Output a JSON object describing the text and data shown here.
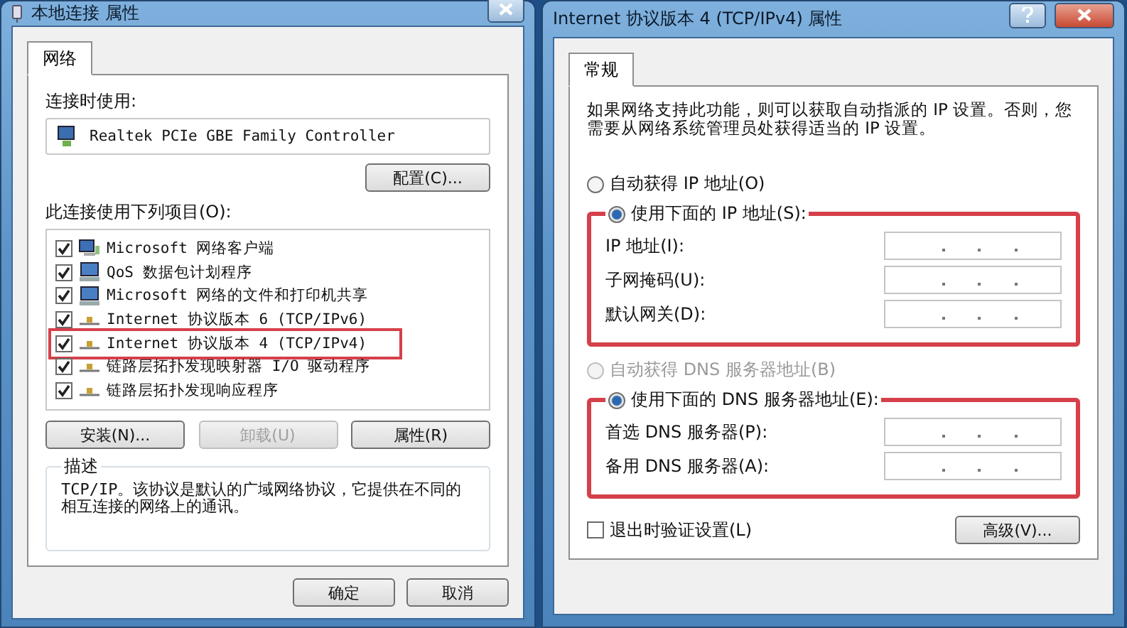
{
  "left_window": {
    "title": "本地连接 属性",
    "tabs": [
      {
        "label": "网络",
        "selected": true
      }
    ],
    "connect_using_label": "连接时使用:",
    "adapter": "Realtek PCIe GBE Family Controller",
    "configure_button": "配置(C)...",
    "items_label": "此连接使用下列项目(O):",
    "items": [
      {
        "kind": "client",
        "label": "Microsoft 网络客户端",
        "checked": true,
        "highlighted": false
      },
      {
        "kind": "service",
        "label": "QoS 数据包计划程序",
        "checked": true,
        "highlighted": false
      },
      {
        "kind": "service",
        "label": "Microsoft 网络的文件和打印机共享",
        "checked": true,
        "highlighted": false
      },
      {
        "kind": "protocol",
        "label": "Internet 协议版本 6 (TCP/IPv6)",
        "checked": true,
        "highlighted": false
      },
      {
        "kind": "protocol",
        "label": "Internet 协议版本 4 (TCP/IPv4)",
        "checked": true,
        "highlighted": true
      },
      {
        "kind": "protocol",
        "label": "链路层拓扑发现映射器 I/O 驱动程序",
        "checked": true,
        "highlighted": false
      },
      {
        "kind": "protocol",
        "label": "链路层拓扑发现响应程序",
        "checked": true,
        "highlighted": false
      }
    ],
    "item_buttons": [
      {
        "label": "安装(N)...",
        "disabled": false
      },
      {
        "label": "卸载(U)",
        "disabled": true
      },
      {
        "label": "属性(R)",
        "disabled": false
      }
    ],
    "description": {
      "title": "描述",
      "text": "TCP/IP。该协议是默认的广域网络协议，它提供在不同的相互连接的网络上的通讯。"
    },
    "footer_buttons": [
      "确定",
      "取消"
    ]
  },
  "right_window": {
    "title": "Internet 协议版本 4 (TCP/IPv4) 属性",
    "tabs": [
      {
        "label": "常规",
        "selected": true
      }
    ],
    "intro": "如果网络支持此功能，则可以获取自动指派的 IP 设置。否则，您需要从网络系统管理员处获得适当的 IP 设置。",
    "ip_auto": {
      "label": "自动获得 IP 地址(O)",
      "selected": false,
      "disabled": false
    },
    "ip_manual": {
      "label": "使用下面的 IP 地址(S):",
      "selected": true,
      "highlighted": true,
      "fields": [
        {
          "label": "IP 地址(I):"
        },
        {
          "label": "子网掩码(U):"
        },
        {
          "label": "默认网关(D):"
        }
      ]
    },
    "dns_auto": {
      "label": "自动获得 DNS 服务器地址(B)",
      "selected": false,
      "disabled": true
    },
    "dns_manual": {
      "label": "使用下面的 DNS 服务器地址(E):",
      "selected": true,
      "highlighted": true,
      "fields": [
        {
          "label": "首选 DNS 服务器(P):"
        },
        {
          "label": "备用 DNS 服务器(A):"
        }
      ]
    },
    "validate": {
      "label": "退出时验证设置(L)",
      "checked": false
    },
    "advanced_button": "高级(V)..."
  }
}
